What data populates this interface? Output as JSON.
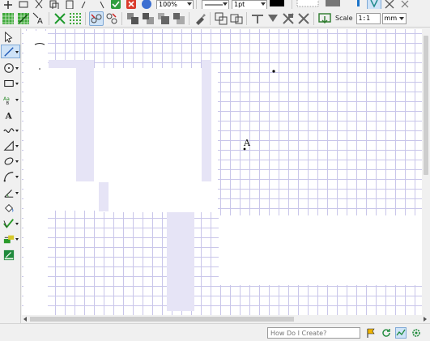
{
  "toolbar_top": {
    "zoom_value": "100%",
    "line_width_value": "1pt",
    "icons": [
      "new-icon",
      "print-icon",
      "cut-icon",
      "copy-icon",
      "paste-icon",
      "undo-icon",
      "redo-icon",
      "check-icon",
      "cancel-icon",
      "help-icon",
      "line-style-icon",
      "line-color-icon",
      "fill-pattern-icon",
      "fill-color-icon",
      "snap-icon",
      "scissors-icon",
      "lock-icon"
    ]
  },
  "toolbar_second": {
    "scale_label": "Scale",
    "scale_value": "1:1",
    "unit_value": "mm",
    "icons": [
      "grid-icon",
      "snap-grid-icon",
      "text-format-icon",
      "delete-icon",
      "points-grid-icon",
      "link-icon",
      "unlink-icon",
      "bring-front-icon",
      "send-back-icon",
      "bring-forward-icon",
      "send-backward-icon",
      "brush-icon",
      "group-icon",
      "ungroup-icon",
      "align-icon",
      "align-top-icon",
      "align-middle-icon",
      "align-bottom-icon",
      "export-icon"
    ]
  },
  "toolbox": {
    "tools": [
      "select-tool",
      "line-tool",
      "circle-tool",
      "rectangle-tool",
      "text-tool",
      "label-tool",
      "curve-tool",
      "polygon-tool",
      "ellipse-tool",
      "arc-tool",
      "angle-tool",
      "fill-tool",
      "vector-tool",
      "stamp-tool",
      "drawing-pad-tool"
    ]
  },
  "canvas": {
    "label_A": "A"
  },
  "statusbar": {
    "help_placeholder": "How Do I Create?",
    "icons": [
      "flag-icon",
      "refresh-icon",
      "view-icon",
      "settings-icon"
    ]
  },
  "colors": {
    "grid_line": "#c9c6ea",
    "selection_shade": "#e6e4f6",
    "active_button": "#cfe3f7",
    "toolbar_bg": "#f0f0f0"
  }
}
